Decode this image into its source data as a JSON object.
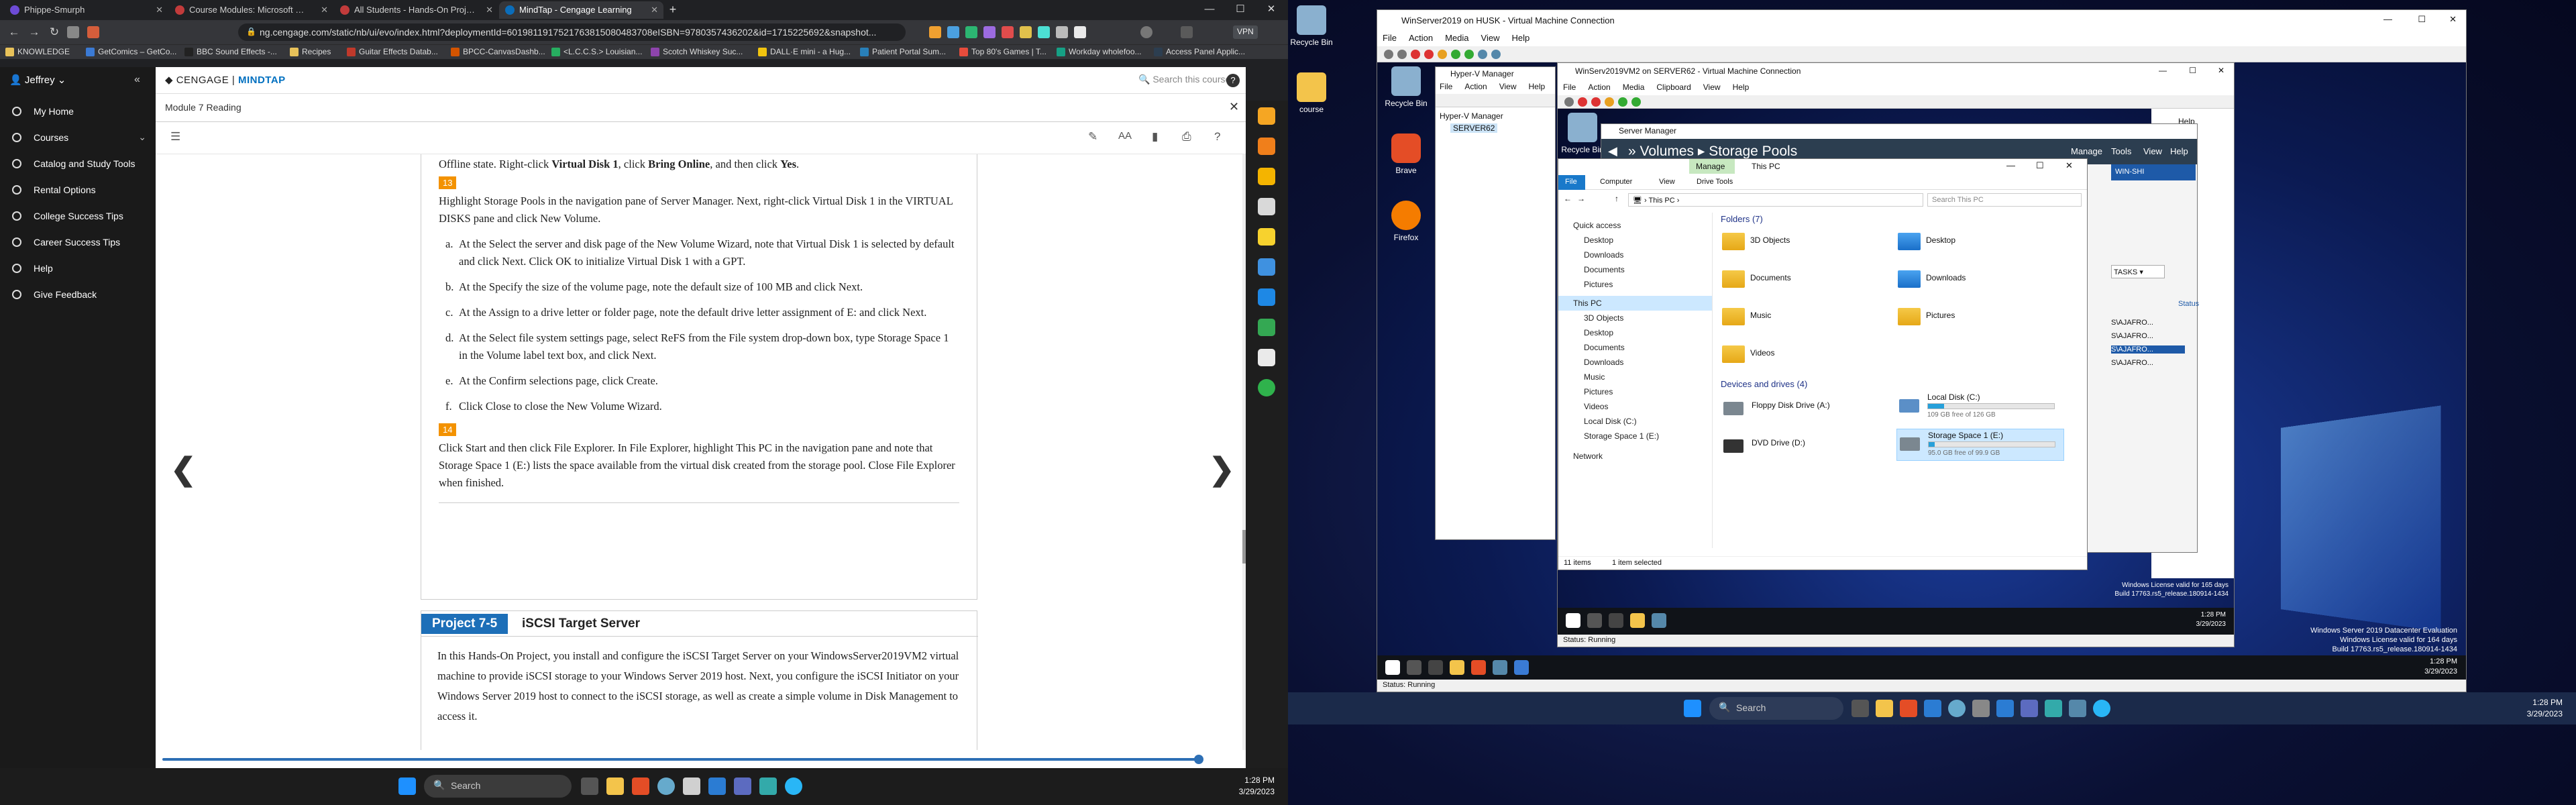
{
  "browser": {
    "tabs": [
      {
        "label": "Phippe-Smurph"
      },
      {
        "label": "Course Modules: Microsoft Windows"
      },
      {
        "label": "All Students - Hands-On Project 7-4 -"
      },
      {
        "label": "MindTap - Cengage Learning"
      }
    ],
    "new_tab": "+",
    "url": "ng.cengage.com/static/nb/ui/evo/index.html?deploymentId=6019811917521763815080483708eISBN=9780357436202&id=1715225692&snapshot...",
    "vpn_label": "VPN",
    "bookmarks": [
      "KNOWLEDGE",
      "GetComics – GetCo...",
      "BBC Sound Effects -...",
      "Recipes",
      "Guitar Effects Datab...",
      "BPCC-CanvasDashb...",
      "<L.C.C.S.> Louisian...",
      "Scotch Whiskey Suc...",
      "DALL·E mini - a Hug...",
      "Patient Portal Sum...",
      "Top 80's Games | T...",
      "Workday wholefoo...",
      "Access Panel Applic..."
    ]
  },
  "cengage": {
    "user": "Jeffrey",
    "brand_left": "CENGAGE",
    "brand_right": "MINDTAP",
    "search_placeholder": "Search this course",
    "sidebar": [
      "My Home",
      "Courses",
      "Catalog and Study Tools",
      "Rental Options",
      "College Success Tips",
      "Career Success Tips",
      "Help",
      "Give Feedback"
    ],
    "reader_title": "Module 7 Reading",
    "intro_before": "Offline state. Right-click ",
    "intro_b1": "Virtual Disk 1",
    "intro_mid": ", click ",
    "intro_b2": "Bring Online",
    "intro_mid2": ", and then click ",
    "intro_b3": "Yes",
    "intro_end": ".",
    "step13": "13",
    "step13_text": "Highlight Storage Pools in the navigation pane of Server Manager. Next, right-click Virtual Disk 1 in the VIRTUAL DISKS pane and click New Volume.",
    "items": [
      {
        "l": "a.",
        "t": "At the Select the server and disk page of the New Volume Wizard, note that Virtual Disk 1 is selected by default and click Next. Click OK to initialize Virtual Disk 1 with a GPT."
      },
      {
        "l": "b.",
        "t": "At the Specify the size of the volume page, note the default size of 100 MB and click Next."
      },
      {
        "l": "c.",
        "t": "At the Assign to a drive letter or folder page, note the default drive letter assignment of E: and click Next."
      },
      {
        "l": "d.",
        "t": "At the Select file system settings page, select ReFS from the File system drop-down box, type Storage Space 1 in the Volume label text box, and click Next."
      },
      {
        "l": "e.",
        "t": "At the Confirm selections page, click Create."
      },
      {
        "l": "f.",
        "t": "Click Close to close the New Volume Wizard."
      }
    ],
    "step14": "14",
    "step14_text": "Click Start and then click File Explorer. In File Explorer, highlight This PC in the navigation pane and note that Storage Space 1 (E:) lists the space available from the virtual disk created from the storage pool. Close File Explorer when finished.",
    "project_tag": "Project 7-5",
    "project_title": "iSCSI Target Server",
    "project_text": "In this Hands-On Project, you install and configure the iSCSI Target Server on your WindowsServer2019VM2 virtual machine to provide iSCSI storage to your Windows Server 2019 host. Next, you configure the iSCSI Initiator on your Windows Server 2019 host to connect to the iSCSI storage, as well as create a simple volume in Disk Management to access it."
  },
  "taskbar_left": {
    "search": "Search",
    "time": "1:28 PM",
    "date": "3/29/2023"
  },
  "desktop": {
    "icons": [
      "Recycle Bin",
      "course"
    ],
    "outer_vm": {
      "title": "WinServer2019 on HUSK - Virtual Machine Connection",
      "menu": [
        "File",
        "Action",
        "Media",
        "View",
        "Help"
      ],
      "guest_icons": [
        "Recycle Bin",
        "Brave",
        "Firefox"
      ],
      "hyperv_title": "Hyper-V Manager",
      "hyperv_menu": [
        "File",
        "Action",
        "View",
        "Help"
      ],
      "hyperv_tree": [
        "Hyper-V Manager",
        "SERVER62"
      ],
      "status": "Status: Running",
      "watermark": [
        "Windows Server 2019 Datacenter Evaluation",
        "Windows License valid for 164 days",
        "Build 17763.rs5_release.180914-1434"
      ],
      "time": "1:28 PM",
      "date": "3/29/2023"
    },
    "inner_vm": {
      "title": "WinServ2019VM2 on SERVER62 - Virtual Machine Connection",
      "menu": [
        "File",
        "Action",
        "Media",
        "Clipboard",
        "View",
        "Help"
      ],
      "guest_icon": "Recycle Bin",
      "status": "Status: Running",
      "watermark": [
        "Windows License valid for 165 days",
        "Build 17763.rs5_release.180914-1434"
      ],
      "time": "1:28 PM",
      "date": "3/29/2023",
      "help_label": "Help"
    },
    "server_manager": {
      "title": "Server Manager",
      "crumb1": "Volumes",
      "crumb2": "Storage Pools",
      "menu": [
        "Manage",
        "Tools",
        "View",
        "Help"
      ],
      "right_label": "WIN-SHI",
      "tasks": "TASKS",
      "status_col": "Status",
      "rows": [
        "S\\AJAFRO...",
        "S\\AJAFRO...",
        "S\\AJAFRO...",
        "S\\AJAFRO..."
      ]
    },
    "explorer": {
      "tab_manage": "Manage",
      "title": "This PC",
      "ribbon": [
        "File",
        "Computer",
        "View",
        "Drive Tools"
      ],
      "path": "This PC",
      "search_placeholder": "Search This PC",
      "nav": [
        "Quick access",
        "Desktop",
        "Downloads",
        "Documents",
        "Pictures",
        "This PC",
        "3D Objects",
        "Desktop",
        "Documents",
        "Downloads",
        "Music",
        "Pictures",
        "Videos",
        "Local Disk (C:)",
        "Storage Space 1 (E:)",
        "Network"
      ],
      "folders_header": "Folders (7)",
      "folders": [
        "3D Objects",
        "Desktop",
        "Documents",
        "Downloads",
        "Music",
        "Pictures",
        "Videos"
      ],
      "drives_header": "Devices and drives (4)",
      "drives": [
        {
          "name": "Floppy Disk Drive (A:)",
          "free": "",
          "fill": 0
        },
        {
          "name": "Local Disk (C:)",
          "free": "109 GB free of 126 GB",
          "fill": 0.13
        },
        {
          "name": "DVD Drive (D:)",
          "free": "",
          "fill": 0
        },
        {
          "name": "Storage Space 1 (E:)",
          "free": "95.0 GB free of 99.9 GB",
          "fill": 0.05
        }
      ],
      "status_items": "11 items",
      "status_selected": "1 item selected"
    },
    "taskbar_search": "Search",
    "time": "1:28 PM",
    "date": "3/29/2023"
  }
}
